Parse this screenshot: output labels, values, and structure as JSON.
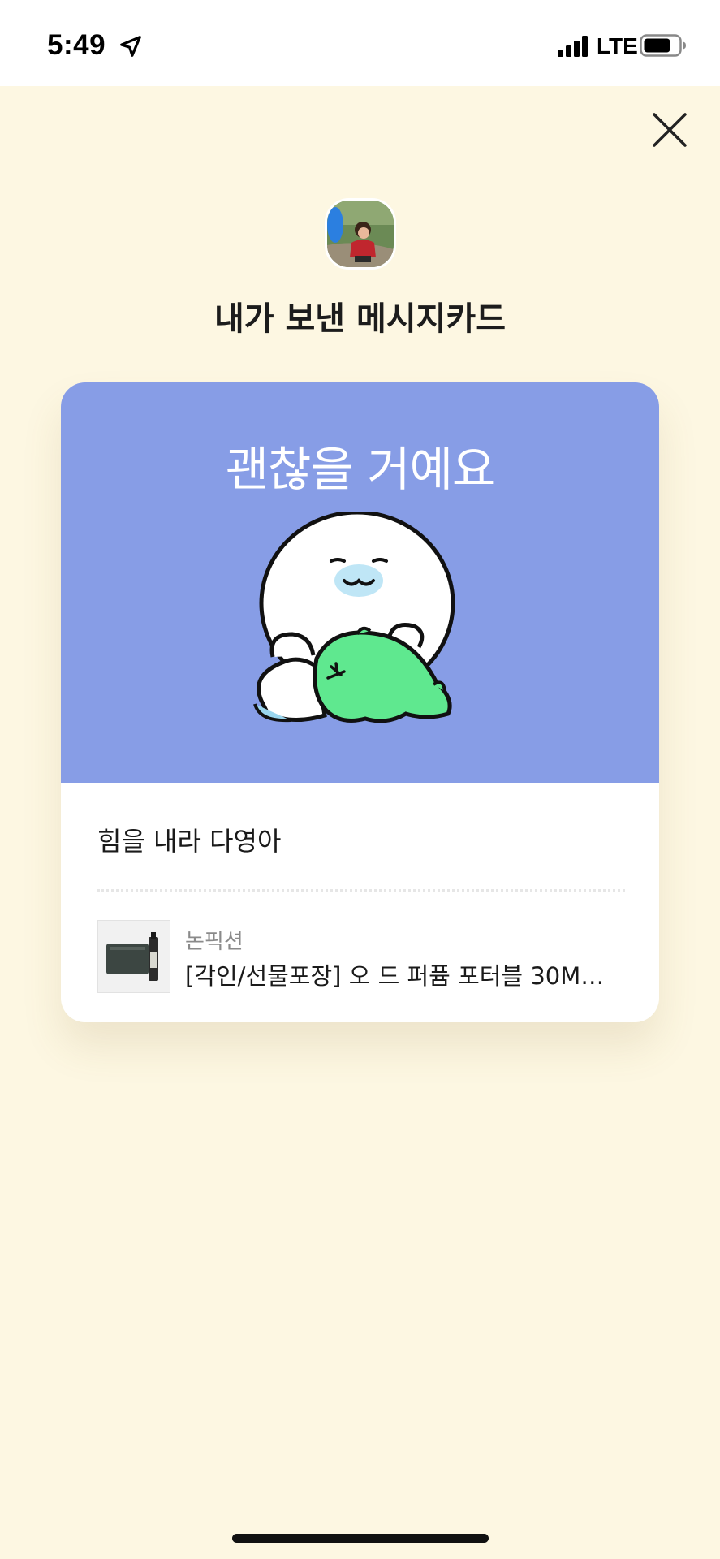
{
  "status_bar": {
    "time": "5:49",
    "network": "LTE"
  },
  "header": {
    "title": "내가 보낸 메시지카드"
  },
  "card": {
    "banner_text": "괜찮을 거예요",
    "banner_color": "#879de6",
    "message": "힘을 내라 다영아",
    "product": {
      "brand": "논픽션",
      "name": "[각인/선물포장] 오 드 퍼퓸 포터블 30M…"
    }
  },
  "colors": {
    "background": "#fdf7e2",
    "card": "#ffffff"
  },
  "icons": {
    "close": "close-icon",
    "location": "location-arrow-icon",
    "signal": "signal-icon",
    "battery": "battery-icon"
  }
}
